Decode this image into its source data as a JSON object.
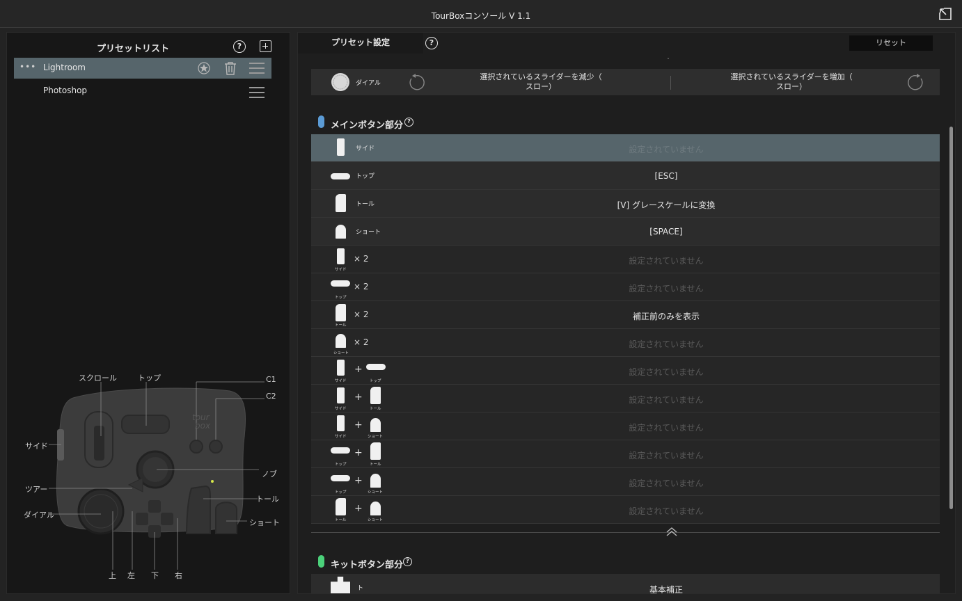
{
  "window": {
    "title": "TourBoxコンソール V 1.1"
  },
  "left": {
    "header": "プリセットリスト",
    "help": "?",
    "presets": [
      {
        "name": "Lightroom",
        "active": true
      },
      {
        "name": "Photoshop",
        "active": false
      }
    ],
    "device_labels": {
      "scroll": "スクロール",
      "top": "トップ",
      "c1": "C1",
      "c2": "C2",
      "side": "サイド",
      "knob": "ノブ",
      "tour": "ツアー",
      "tall": "トール",
      "dial": "ダイアル",
      "short": "ショート",
      "up": "上",
      "left": "左",
      "down": "下",
      "right": "右",
      "logo_line1": "tour",
      "logo_line2": "box"
    }
  },
  "right": {
    "tab": "プリセット設定",
    "help": "?",
    "reset": "リセット",
    "dial_row": {
      "label": "ダイアル",
      "decrease_line1": "選択されているスライダーを減少（",
      "decrease_line2": "スロー）",
      "increase_line1": "選択されているスライダーを増加（",
      "increase_line2": "スロー）"
    },
    "main_section": {
      "title": "メインボタン部分",
      "help": "?",
      "pill_color": "#5b9bd5"
    },
    "kit_section": {
      "title": "キットボタン部分",
      "help": "?",
      "pill_color": "#4bd17a"
    },
    "main_rows": [
      {
        "label": "サイド",
        "value": "設定されていません"
      },
      {
        "label": "トップ",
        "value": "[ESC]"
      },
      {
        "label": "トール",
        "value": "[V] グレースケールに変換"
      },
      {
        "label": "ショート",
        "value": "[SPACE]"
      }
    ],
    "times": "× 2",
    "plus": "+",
    "combo_rows": [
      {
        "sub_a": "サイド",
        "value": "設定されていません"
      },
      {
        "sub_a": "トップ",
        "value": "設定されていません"
      },
      {
        "sub_a": "トール",
        "value": "補正前のみを表示"
      },
      {
        "sub_a": "ショート",
        "value": "設定されていません"
      },
      {
        "sub_a": "サイド",
        "sub_b": "トップ",
        "value": "設定されていません"
      },
      {
        "sub_a": "サイド",
        "sub_b": "トール",
        "value": "設定されていません"
      },
      {
        "sub_a": "サイド",
        "sub_b": "ショート",
        "value": "設定されていません"
      },
      {
        "sub_a": "トップ",
        "sub_b": "トール",
        "value": "設定されていません"
      },
      {
        "sub_a": "トップ",
        "sub_b": "ショート",
        "value": "設定されていません"
      },
      {
        "sub_a": "トール",
        "sub_b": "ショート",
        "value": "設定されていません"
      }
    ],
    "kit_first_row": {
      "label": "ト",
      "value": "基本補正"
    }
  }
}
